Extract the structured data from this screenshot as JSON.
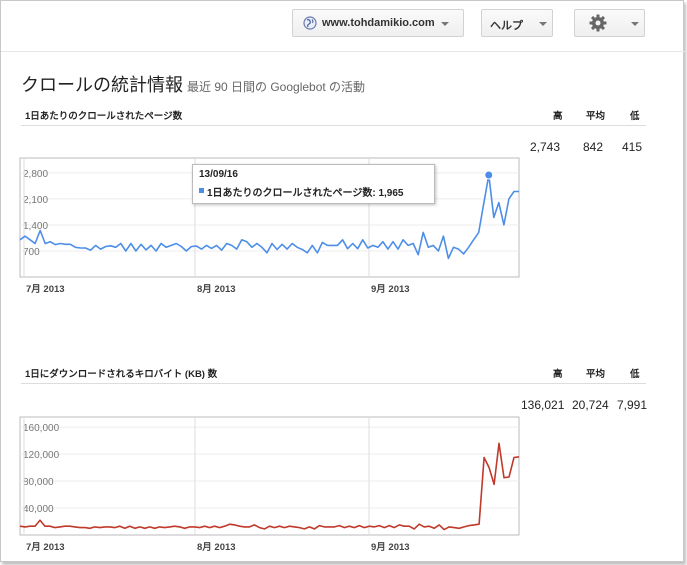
{
  "site_selector": {
    "label": "www.tohdamikio.com"
  },
  "help_menu": {
    "label": "ヘルプ"
  },
  "page": {
    "title": "クロールの統計情報",
    "subtitle": "最近 90 日間の Googlebot の活動"
  },
  "charts": [
    {
      "section_title": "1日あたりのクロールされたページ数",
      "columns": [
        "高",
        "平均",
        "低"
      ],
      "stats": {
        "high": "2,743",
        "avg": "842",
        "low": "415"
      },
      "tooltip": {
        "date": "13/09/16",
        "label": "1日あたりのクロールされたページ数: 1,965"
      }
    },
    {
      "section_title": "1日にダウンロードされるキロバイト (KB) 数",
      "columns": [
        "高",
        "平均",
        "低"
      ],
      "stats": {
        "high": "136,021",
        "avg": "20,724",
        "low": "7,991"
      }
    }
  ],
  "chart_data": [
    {
      "type": "line",
      "title": "1日あたりのクロールされたページ数",
      "color": "#4d8ee8",
      "x_ticks": [
        "7月 2013",
        "8月 2013",
        "9月 2013"
      ],
      "y_ticks": [
        "700",
        "1,400",
        "2,100",
        "2,800"
      ],
      "ylim": [
        0,
        3200
      ],
      "grid": true,
      "values": [
        1000,
        1100,
        1000,
        900,
        1250,
        900,
        950,
        870,
        900,
        880,
        880,
        800,
        780,
        780,
        720,
        850,
        750,
        820,
        840,
        800,
        900,
        700,
        900,
        700,
        880,
        730,
        850,
        700,
        900,
        800,
        850,
        900,
        820,
        700,
        820,
        830,
        750,
        850,
        770,
        850,
        720,
        900,
        850,
        750,
        1000,
        950,
        800,
        900,
        800,
        650,
        900,
        740,
        880,
        750,
        900,
        800,
        740,
        650,
        850,
        650,
        930,
        850,
        850,
        850,
        1000,
        760,
        900,
        760,
        1000,
        780,
        850,
        800,
        950,
        750,
        950,
        750,
        1000,
        850,
        900,
        600,
        1200,
        800,
        850,
        700,
        1100,
        500,
        800,
        750,
        620,
        800,
        1000,
        1200,
        1965,
        2743,
        1600,
        2000,
        1400,
        2100,
        2300,
        2300
      ]
    },
    {
      "type": "line",
      "title": "1日にダウンロードされるキロバイト (KB) 数",
      "color": "#c0392b",
      "x_ticks": [
        "7月 2013",
        "8月 2013",
        "9月 2013"
      ],
      "y_ticks": [
        "40,000",
        "80,000",
        "120,000",
        "160,000"
      ],
      "ylim": [
        0,
        175000
      ],
      "grid": true,
      "values": [
        13000,
        12000,
        13000,
        13000,
        22000,
        13000,
        13000,
        11000,
        12000,
        13000,
        13000,
        12000,
        11000,
        11000,
        10000,
        12000,
        11000,
        12000,
        12000,
        11000,
        13000,
        10000,
        13000,
        10000,
        12000,
        10000,
        12000,
        10000,
        12000,
        11000,
        12000,
        13000,
        12000,
        10000,
        12000,
        12000,
        11000,
        13000,
        11000,
        13000,
        11000,
        13000,
        16000,
        15000,
        13000,
        12000,
        12000,
        15000,
        11000,
        9000,
        13000,
        11000,
        13000,
        11000,
        13000,
        12000,
        11000,
        9000,
        12000,
        9000,
        14000,
        12000,
        12000,
        12000,
        14000,
        11000,
        13000,
        11000,
        14000,
        11000,
        13000,
        12000,
        14000,
        11000,
        14000,
        11000,
        15000,
        13000,
        13000,
        9000,
        16000,
        12000,
        13000,
        10000,
        15000,
        8000,
        12000,
        11000,
        10000,
        12000,
        14000,
        15000,
        16000,
        115000,
        100000,
        75000,
        136021,
        85000,
        86000,
        115000,
        116000
      ]
    }
  ]
}
